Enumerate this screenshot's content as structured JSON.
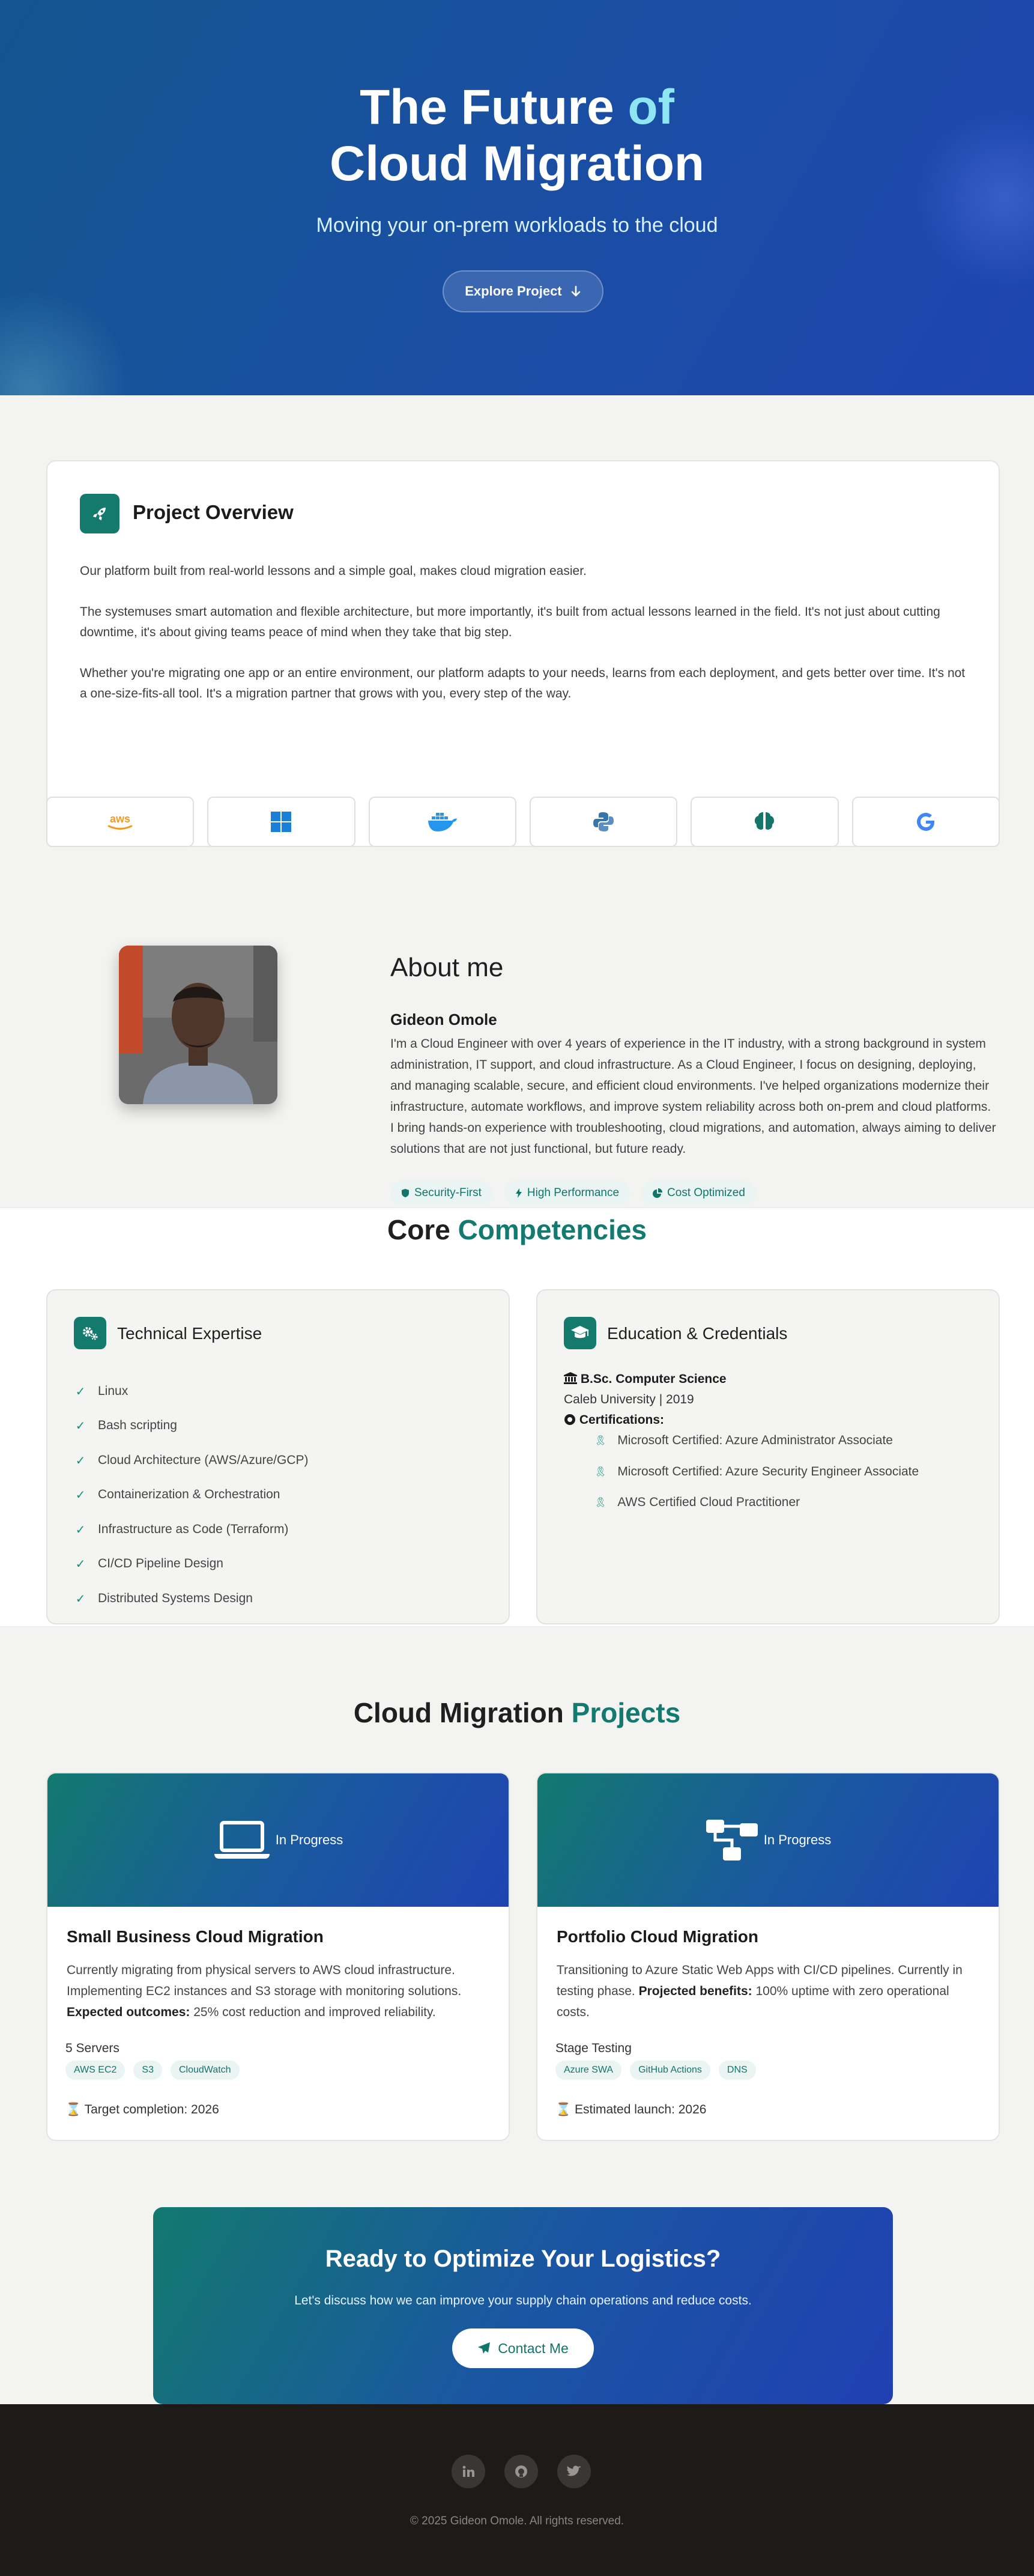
{
  "hero": {
    "title_line1_a": "The Future",
    "title_line1_b": "of",
    "title_line2": "Cloud Migration",
    "subtitle": "Moving your on-prem workloads to the cloud",
    "button_label": "Explore Project",
    "button_icon": "arrow-down-icon"
  },
  "overview": {
    "title": "Project Overview",
    "icon": "rocket-icon",
    "p1": "Our platform built from real-world lessons and a simple goal, makes cloud migration easier.",
    "p2": "The systemuses smart automation and flexible architecture, but more importantly, it's built from actual lessons learned in the field. It's not just about cutting downtime, it's about giving teams peace of mind when they take that big step.",
    "p3": "Whether you're migrating one app or an entire environment, our platform adapts to your needs, learns from each deployment, and gets better over time. It's not a one-size-fits-all tool. It's a migration partner that grows with you, every step of the way.",
    "tech_icons": [
      "aws-icon",
      "windows-icon",
      "docker-icon",
      "python-icon",
      "brain-icon",
      "google-icon"
    ],
    "colors": {
      "aws": "#f29b24",
      "windows": "#1a7fd6",
      "docker": "#2496ed",
      "python": "#3776ab",
      "brain": "#15756b",
      "google": "#4285f4"
    }
  },
  "about": {
    "heading": "About me",
    "name": "Gideon Omole",
    "bio": "I'm a Cloud Engineer with over 4 years of experience in the IT industry, with a strong background in system administration, IT support, and cloud infrastructure. As a Cloud Engineer, I focus on designing, deploying, and managing scalable, secure, and efficient cloud environments. I've helped organizations modernize their infrastructure, automate workflows, and improve system reliability across both on-prem and cloud platforms. I bring hands-on experience with troubleshooting, cloud migrations, and automation, always aiming to deliver solutions that are not just functional, but future ready.",
    "badges": [
      {
        "label": "Security-First",
        "icon": "shield-icon"
      },
      {
        "label": "High Performance",
        "icon": "bolt-icon"
      },
      {
        "label": "Cost Optimized",
        "icon": "pie-chart-icon"
      }
    ]
  },
  "competencies": {
    "title_a": "Core",
    "title_b": "Competencies",
    "technical": {
      "title": "Technical Expertise",
      "icon": "gears-icon",
      "items": [
        "Linux",
        "Bash scripting",
        "Cloud Architecture (AWS/Azure/GCP)",
        "Containerization & Orchestration",
        "Infrastructure as Code (Terraform)",
        "CI/CD Pipeline Design",
        "Distributed Systems Design"
      ]
    },
    "education": {
      "title": "Education & Credentials",
      "icon": "graduation-cap-icon",
      "degree": "B.Sc. Computer Science",
      "school": "Caleb University | 2019",
      "cert_heading": "Certifications:",
      "certs": [
        "Microsoft Certified: Azure Administrator Associate",
        "Microsoft Certified: Azure Security Engineer Associate",
        "AWS Certified Cloud Practitioner"
      ]
    }
  },
  "projects": {
    "title_a": "Cloud Migration",
    "title_b": "Projects",
    "items": [
      {
        "icon": "laptop-icon",
        "status": "In Progress",
        "title": "Small Business Cloud Migration",
        "desc": "Currently migrating from physical servers to AWS cloud infrastructure. Implementing EC2 instances and S3 storage with monitoring solutions.",
        "outcome_label": "Expected outcomes:",
        "outcome_text": "25% cost reduction and improved reliability.",
        "meta": "5 Servers",
        "tags": [
          "AWS EC2",
          "S3",
          "CloudWatch"
        ],
        "footer": "Target completion: 2026"
      },
      {
        "icon": "sitemap-icon",
        "status": "In Progress",
        "title": "Portfolio Cloud Migration",
        "desc": "Transitioning to Azure Static Web Apps with CI/CD pipelines. Currently in testing phase.",
        "outcome_label": "Projected benefits:",
        "outcome_text": "100% uptime with zero operational costs.",
        "meta": "Stage Testing",
        "tags": [
          "Azure SWA",
          "GitHub Actions",
          "DNS"
        ],
        "footer": "Estimated launch: 2026"
      }
    ]
  },
  "cta": {
    "title": "Ready to Optimize Your Logistics?",
    "text": "Let's discuss how we can improve your supply chain operations and reduce costs.",
    "button_label": "Contact Me",
    "button_icon": "paper-plane-icon"
  },
  "footer": {
    "socials": [
      "linkedin-icon",
      "github-icon",
      "twitter-icon"
    ],
    "copyright": "© 2025 Gideon Omole. All rights reserved."
  }
}
